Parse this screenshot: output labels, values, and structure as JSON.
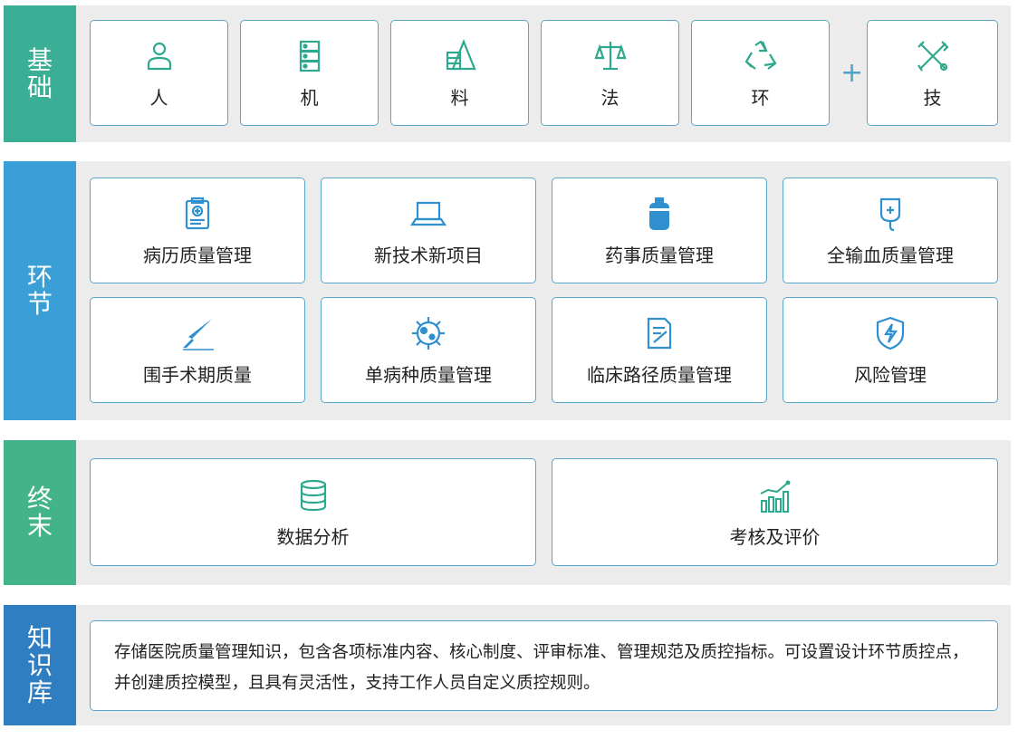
{
  "colors": {
    "basic_sidebar": "#3aaf96",
    "process_sidebar": "#3a9fd6",
    "terminal_sidebar": "#43b48a",
    "knowledge_sidebar": "#2f7ec2",
    "card_border": "#5aa6c8",
    "icon_teal": "#2ea88e",
    "icon_blue": "#2f8fcf"
  },
  "basic": {
    "title": "基础",
    "items": [
      {
        "label": "人",
        "icon": "person-icon"
      },
      {
        "label": "机",
        "icon": "server-icon"
      },
      {
        "label": "料",
        "icon": "material-icon"
      },
      {
        "label": "法",
        "icon": "scale-icon"
      },
      {
        "label": "环",
        "icon": "recycle-icon"
      }
    ],
    "plus": "+",
    "extra": {
      "label": "技",
      "icon": "tools-icon"
    }
  },
  "process": {
    "title": "环节",
    "items": [
      {
        "label": "病历质量管理",
        "icon": "clipboard-icon"
      },
      {
        "label": "新技术新项目",
        "icon": "laptop-icon"
      },
      {
        "label": "药事质量管理",
        "icon": "medicine-bottle-icon"
      },
      {
        "label": "全输血质量管理",
        "icon": "blood-bag-icon"
      },
      {
        "label": "围手术期质量",
        "icon": "scalpel-icon"
      },
      {
        "label": "单病种质量管理",
        "icon": "virus-icon"
      },
      {
        "label": "临床路径质量管理",
        "icon": "document-edit-icon"
      },
      {
        "label": "风险管理",
        "icon": "shield-lightning-icon"
      }
    ]
  },
  "terminal": {
    "title": "终末",
    "items": [
      {
        "label": "数据分析",
        "icon": "database-icon"
      },
      {
        "label": "考核及评价",
        "icon": "bar-chart-icon"
      }
    ]
  },
  "knowledge": {
    "title": "知识库",
    "text": "存储医院质量管理知识，包含各项标准内容、核心制度、评审标准、管理规范及质控指标。可设置设计环节质控点，并创建质控模型，且具有灵活性，支持工作人员自定义质控规则。"
  }
}
